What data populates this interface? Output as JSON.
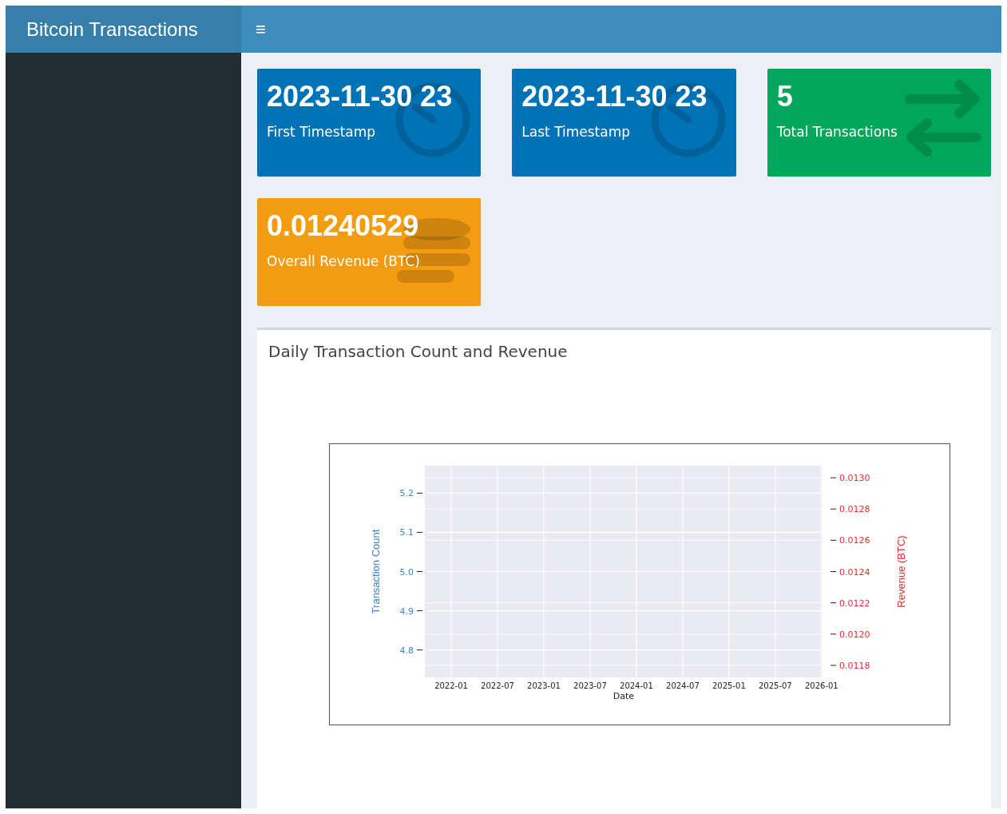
{
  "header": {
    "title": "Bitcoin Transactions",
    "menu_icon": "≡"
  },
  "value_boxes": [
    {
      "value": "2023-11-30 23",
      "label": "First Timestamp",
      "color": "#0073b7",
      "kind": "clock"
    },
    {
      "value": "2023-11-30 23",
      "label": "Last Timestamp",
      "color": "#0073b7",
      "kind": "clock"
    },
    {
      "value": "5",
      "label": "Total Transactions",
      "color": "#00a65a",
      "kind": "exchange"
    },
    {
      "value": "0.01240529",
      "label": "Overall Revenue (BTC)",
      "color": "#f39c12",
      "kind": "coins"
    }
  ],
  "chart_box": {
    "title": "Daily Transaction Count and Revenue",
    "chart_data": {
      "type": "line",
      "xlabel": "Date",
      "ylabel": "Transaction Count",
      "y2label": "Revenue (BTC)",
      "grid": true,
      "ylim": [
        4.73,
        5.27
      ],
      "y2lim": [
        0.011723,
        0.013077
      ],
      "categories": [
        "2022-01",
        "2022-07",
        "2023-01",
        "2023-07",
        "2024-01",
        "2024-07",
        "2025-01",
        "2025-07",
        "2026-01"
      ],
      "yticks": [
        {
          "value": 4.8,
          "label": "4.8"
        },
        {
          "value": 4.9,
          "label": "4.9"
        },
        {
          "value": 5.0,
          "label": "5.0"
        },
        {
          "value": 5.1,
          "label": "5.1"
        },
        {
          "value": 5.2,
          "label": "5.2"
        }
      ],
      "y2ticks": [
        {
          "value": 0.0118,
          "label": "0.0118"
        },
        {
          "value": 0.012,
          "label": "0.0120"
        },
        {
          "value": 0.0122,
          "label": "0.0122"
        },
        {
          "value": 0.0124,
          "label": "0.0124"
        },
        {
          "value": 0.0126,
          "label": "0.0126"
        },
        {
          "value": 0.0128,
          "label": "0.0128"
        },
        {
          "value": 0.013,
          "label": "0.0130"
        }
      ]
    }
  }
}
